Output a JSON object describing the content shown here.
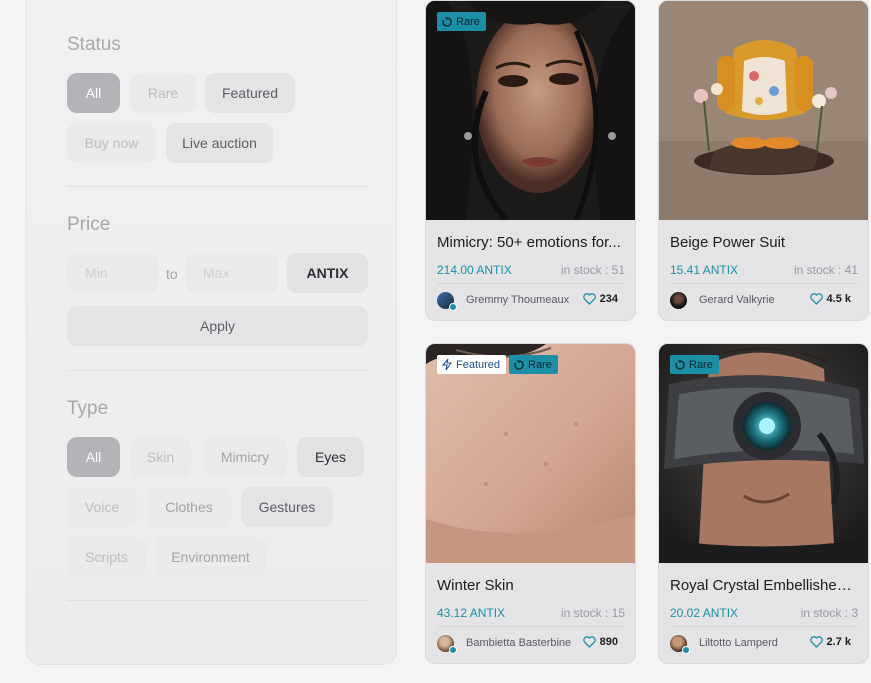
{
  "filters": {
    "status": {
      "title": "Status",
      "options": [
        "All",
        "Rare",
        "Featured",
        "Buy now",
        "Live auction"
      ]
    },
    "price": {
      "title": "Price",
      "min_placeholder": "Min",
      "to_label": "to",
      "max_placeholder": "Max",
      "currency": "ANTIX",
      "apply_label": "Apply"
    },
    "type": {
      "title": "Type",
      "options": [
        "All",
        "Skin",
        "Mimicry",
        "Eyes",
        "Voice",
        "Clothes",
        "Gestures",
        "Scripts",
        "Environment"
      ]
    }
  },
  "cards": [
    {
      "badges": [
        "Rare"
      ],
      "title": "Mimicry: 50+ emotions for...",
      "price": "214.00 ANTIX",
      "stock": "in stock : 51",
      "author": "Gremmy Thoumeaux",
      "likes": "234",
      "verified": true
    },
    {
      "badges": [],
      "title": "Beige Power Suit",
      "price": "15.41 ANTIX",
      "stock": "in stock : 41",
      "author": "Gerard Valkyrie",
      "likes": "4.5 k",
      "verified": false
    },
    {
      "badges": [
        "Featured",
        "Rare"
      ],
      "title": "Winter Skin",
      "price": "43.12 ANTIX",
      "stock": "in stock : 15",
      "author": "Bambietta Basterbine",
      "likes": "890",
      "verified": true
    },
    {
      "badges": [
        "Rare"
      ],
      "title": "Royal Crystal Embellished B...",
      "price": "20.02 ANTIX",
      "stock": "in stock : 3",
      "author": "Liltotto Lamperd",
      "likes": "2.7 k",
      "verified": true
    }
  ],
  "colors": {
    "accent": "#1a8fa6",
    "active_chip": "#b4b4b8",
    "card_bg": "#e4e4e6"
  },
  "icons": [
    "rare-icon",
    "featured-bolt-icon",
    "heart-icon",
    "verified-icon"
  ]
}
